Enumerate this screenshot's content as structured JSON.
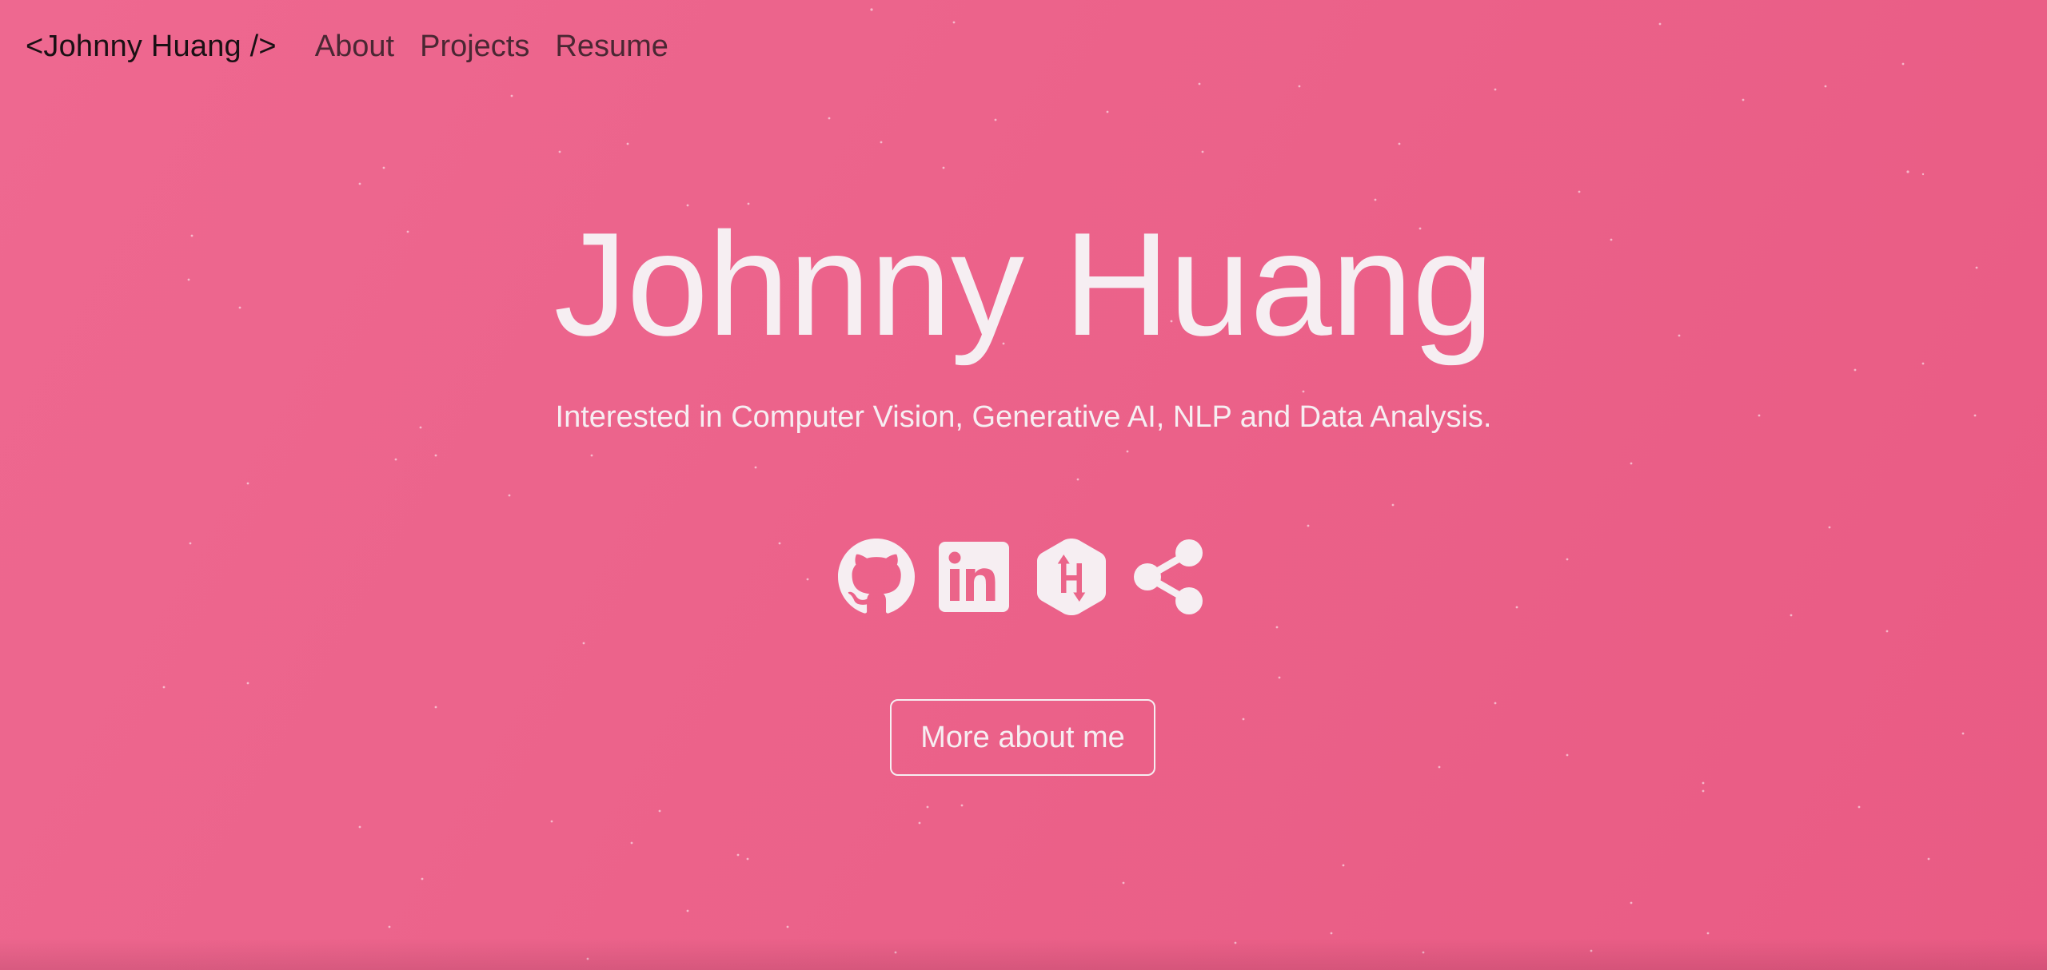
{
  "theme": {
    "background": "#eb6489",
    "foreground": "#f6eef2",
    "brand_text": "#1a1014",
    "nav_text": "#4a2733"
  },
  "nav": {
    "brand": "<Johnny Huang />",
    "links": [
      {
        "label": "About"
      },
      {
        "label": "Projects"
      },
      {
        "label": "Resume"
      }
    ]
  },
  "hero": {
    "title": "Johnny Huang",
    "subtitle": "Interested in Computer Vision, Generative AI, NLP and Data Analysis.",
    "socials": [
      {
        "icon": "github-icon"
      },
      {
        "icon": "linkedin-icon"
      },
      {
        "icon": "hackerrank-icon"
      },
      {
        "icon": "share-icon"
      }
    ],
    "cta_label": "More about me"
  }
}
